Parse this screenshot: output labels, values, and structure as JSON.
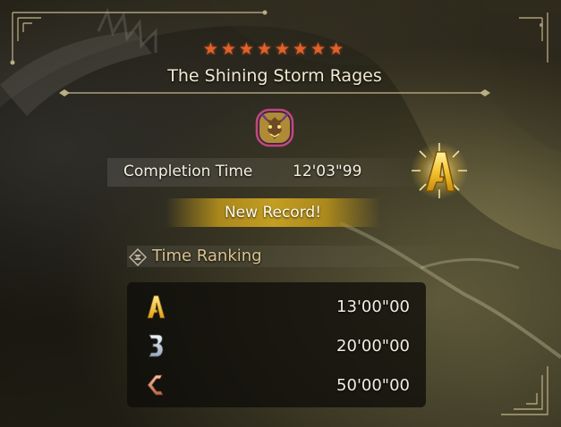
{
  "quest": {
    "star_count": 8,
    "stars": "★★★★★★★★",
    "title": "The Shining Storm Rages"
  },
  "result": {
    "completion_label": "Completion Time",
    "completion_time": "12'03\"99",
    "rank": "A",
    "new_record_label": "New Record!"
  },
  "time_ranking": {
    "title": "Time Ranking",
    "rows": [
      {
        "rank": "A",
        "time": "13'00\"00"
      },
      {
        "rank": "B",
        "time": "20'00\"00"
      },
      {
        "rank": "C",
        "time": "50'00\"00"
      }
    ]
  },
  "colors": {
    "star": "#e4602a",
    "rank_gold": "#f0c030",
    "rank_silver": "#c8d4dc",
    "rank_bronze": "#d08a6a",
    "banner_gold": "#c49e22",
    "ranking_title": "#d9c48e"
  },
  "icons": {
    "monster": "rey-dau-monster-icon",
    "ranking": "hourglass-diamond-icon"
  }
}
